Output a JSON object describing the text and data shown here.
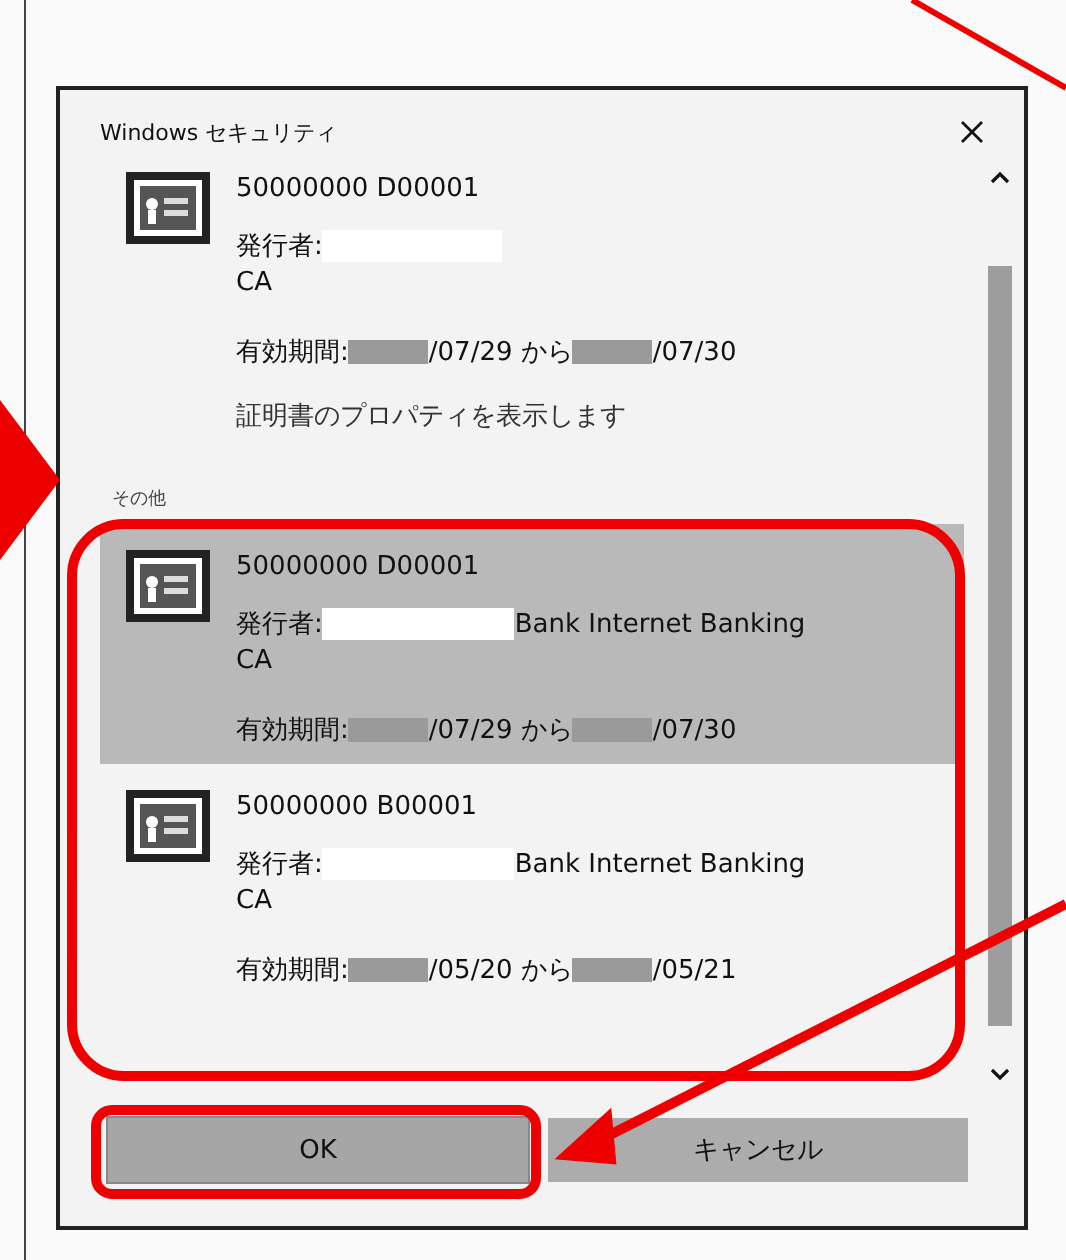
{
  "window": {
    "title": "Windows セキュリティ"
  },
  "current": {
    "name": "50000000 D00001",
    "issuer_label": "発行者:",
    "issuer_line2": "CA",
    "valid_label": "有効期間:",
    "valid_from": "/07/29 から",
    "valid_to": "/07/30",
    "link": "証明書のプロパティを表示します"
  },
  "other_label": "その他",
  "certificates": [
    {
      "name": "50000000 D00001",
      "issuer_label": "発行者:",
      "issuer_name": "Bank Internet Banking",
      "issuer_line2": "CA",
      "valid_label": "有効期間:",
      "valid_from": "/07/29 から",
      "valid_to": "/07/30",
      "selected": true
    },
    {
      "name": "50000000 B00001",
      "issuer_label": "発行者:",
      "issuer_name": "Bank Internet Banking",
      "issuer_line2": "CA",
      "valid_label": "有効期間:",
      "valid_from": "/05/20 から",
      "valid_to": "/05/21",
      "selected": false
    }
  ],
  "buttons": [
    {
      "label": "OK",
      "kind": "primary"
    },
    {
      "label": "キャンセル",
      "kind": "secondary"
    }
  ]
}
